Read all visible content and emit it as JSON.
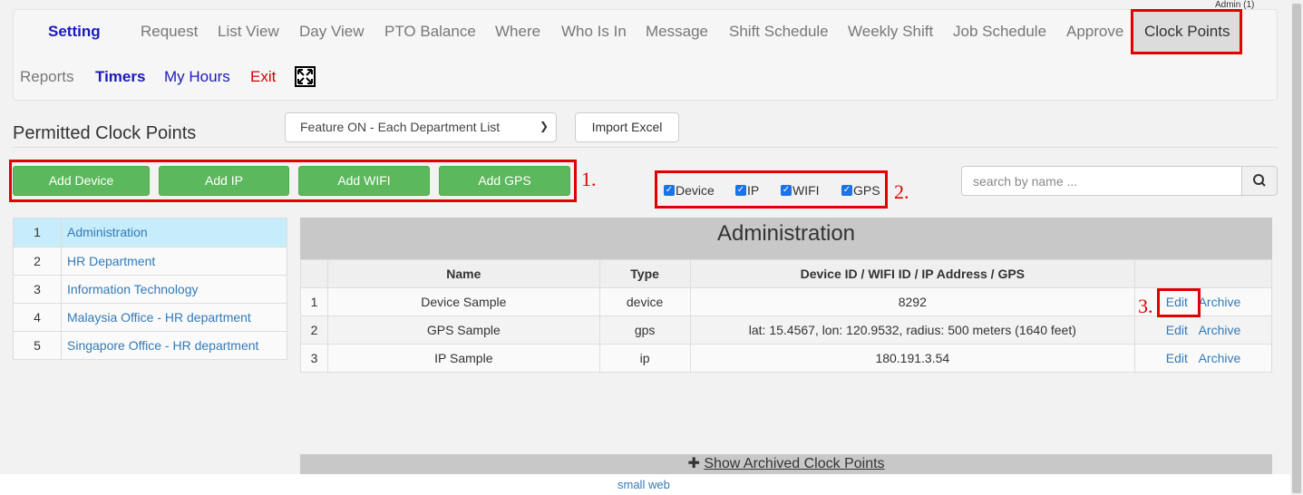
{
  "header": {
    "admin_label": "Admin (1)"
  },
  "nav": {
    "setting": "Setting",
    "request": "Request",
    "list_view": "List View",
    "day_view": "Day View",
    "pto_balance": "PTO Balance",
    "where": "Where",
    "who_is_in": "Who Is In",
    "message": "Message",
    "shift_schedule": "Shift Schedule",
    "weekly_shift": "Weekly Shift",
    "job_schedule": "Job Schedule",
    "approve": "Approve",
    "clock_points": "Clock Points",
    "reports": "Reports",
    "timers": "Timers",
    "my_hours": "My Hours",
    "exit": "Exit"
  },
  "page": {
    "title": "Permitted Clock Points",
    "feature_select": "Feature ON - Each Department List",
    "import_label": "Import Excel",
    "search_placeholder": "search by name ..."
  },
  "buttons": {
    "add_device": "Add Device",
    "add_ip": "Add IP",
    "add_wifi": "Add WIFI",
    "add_gps": "Add GPS"
  },
  "filters": {
    "device": "Device",
    "ip": "IP",
    "wifi": "WIFI",
    "gps": "GPS"
  },
  "annotations": {
    "a1": "1.",
    "a2": "2.",
    "a3": "3."
  },
  "departments": [
    {
      "num": "1",
      "name": "Administration"
    },
    {
      "num": "2",
      "name": "HR Department"
    },
    {
      "num": "3",
      "name": "Information Technology"
    },
    {
      "num": "4",
      "name": "Malaysia Office - HR department"
    },
    {
      "num": "5",
      "name": "Singapore Office - HR department"
    }
  ],
  "panel": {
    "title": "Administration",
    "columns": {
      "name": "Name",
      "type": "Type",
      "id": "Device ID / WIFI ID / IP Address / GPS"
    },
    "rows": [
      {
        "num": "1",
        "name": "Device Sample",
        "type": "device",
        "value": "8292",
        "edit": "Edit",
        "archive": "Archive"
      },
      {
        "num": "2",
        "name": "GPS Sample",
        "type": "gps",
        "value": "lat: 15.4567, lon: 120.9532, radius: 500 meters (1640 feet)",
        "edit": "Edit",
        "archive": "Archive"
      },
      {
        "num": "3",
        "name": "IP Sample",
        "type": "ip",
        "value": "180.191.3.54",
        "edit": "Edit",
        "archive": "Archive"
      }
    ]
  },
  "show_archived": "Show Archived Clock Points",
  "footer": {
    "text": "small web"
  },
  "colors": {
    "accent_green": "#5cb85c",
    "highlight_red": "#e00000",
    "link_blue": "#337ab7",
    "nav_blue": "#1a1abf"
  }
}
